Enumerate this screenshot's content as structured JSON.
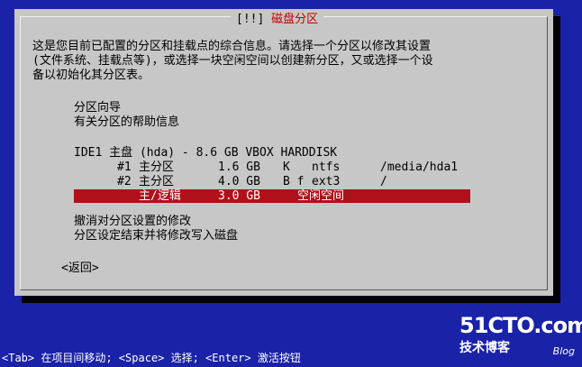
{
  "dialog": {
    "title_prefix": "[!!]",
    "title": "磁盘分区",
    "description_lines": [
      "这是您目前已配置的分区和挂载点的综合信息。请选择一个分区以修改其设置",
      "(文件系统、挂载点等)，或选择一块空闲空间以创建新分区，又或选择一个设",
      "备以初始化其分区表。"
    ],
    "menu": {
      "guided": "分区向导",
      "help": "有关分区的帮助信息",
      "disk": "IDE1 主盘 (hda) - 8.6 GB VBOX HARDDISK",
      "partitions": [
        {
          "num": "#1",
          "type": "主分区",
          "size": "1.6 GB",
          "flags": "K",
          "fs": "ntfs",
          "mount": "/media/hda1"
        },
        {
          "num": "#2",
          "type": "主分区",
          "size": "4.0 GB",
          "flags": "B f",
          "fs": "ext3",
          "mount": "/"
        }
      ],
      "free_space": {
        "type": "主/逻辑",
        "size": "3.0 GB",
        "label": "空闲空间"
      },
      "undo": "撤消对分区设置的修改",
      "finish": "分区设定结束并将修改写入磁盘"
    },
    "back_label": "<返回>"
  },
  "statusbar": {
    "text": "<Tab> 在项目间移动; <Space> 选择; <Enter> 激活按钮"
  },
  "watermark": {
    "site": "51CTO.com",
    "tagline": "技术博客",
    "blog": "Blog"
  },
  "colors": {
    "background": "#1a22a8",
    "dialog": "#c7c7c7",
    "selection": "#b0101a",
    "title": "#c00000"
  }
}
